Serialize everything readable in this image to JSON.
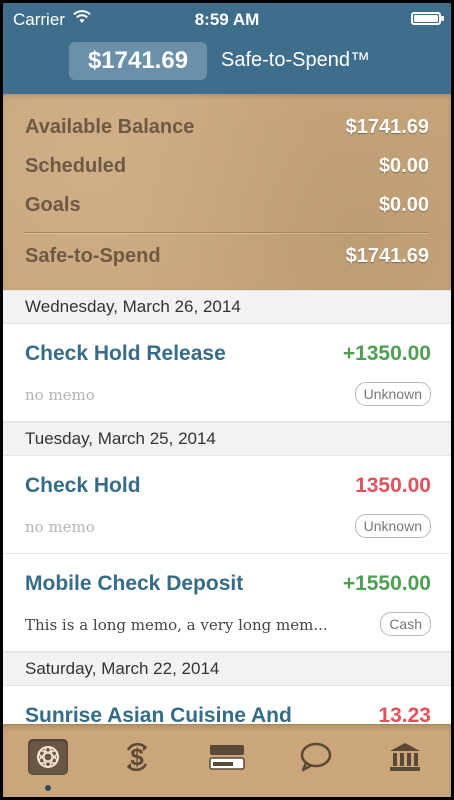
{
  "status_bar": {
    "carrier": "Carrier",
    "time": "8:59 AM"
  },
  "nav": {
    "amount": "$1741.69",
    "title": "Safe-to-Spend™"
  },
  "summary": {
    "rows": [
      {
        "label": "Available Balance",
        "value": "$1741.69"
      },
      {
        "label": "Scheduled",
        "value": "$0.00"
      },
      {
        "label": "Goals",
        "value": "$0.00"
      }
    ],
    "total": {
      "label": "Safe-to-Spend",
      "value": "$1741.69"
    }
  },
  "transactions": {
    "groups": [
      {
        "date": "Wednesday, March 26, 2014",
        "items": [
          {
            "name": "Check Hold Release",
            "amount": "+1350.00",
            "memo": "no memo",
            "tag": "Unknown"
          }
        ]
      },
      {
        "date": "Tuesday, March 25, 2014",
        "items": [
          {
            "name": "Check Hold",
            "amount": "1350.00",
            "memo": "no memo",
            "tag": "Unknown"
          },
          {
            "name": "Mobile Check Deposit",
            "amount": "+1550.00",
            "memo": "This is a long memo, a very long mem...",
            "tag": "Cash"
          }
        ]
      },
      {
        "date": "Saturday, March 22, 2014",
        "items": [
          {
            "name": "Sunrise Asian Cuisine And",
            "amount": "13.23"
          }
        ]
      }
    ]
  },
  "tab_bar": {
    "tabs": [
      "activity-icon",
      "money-transfer-icon",
      "cards-icon",
      "chat-icon",
      "bank-icon"
    ],
    "active_index": 0
  },
  "colors": {
    "nav_blue": "#3f6e8c",
    "paper_tan": "#caa67a",
    "positive_green": "#4f9f53",
    "negative_red": "#e2525c",
    "link_blue": "#356c88"
  }
}
